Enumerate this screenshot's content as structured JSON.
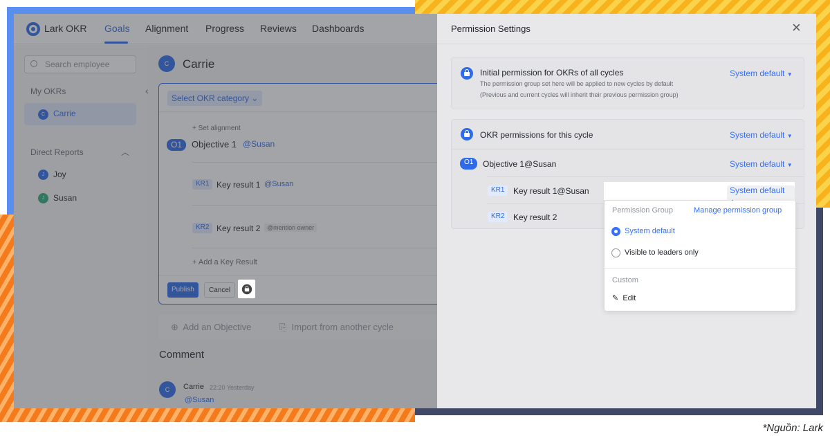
{
  "app": {
    "brand": "Lark OKR",
    "nav": [
      "Goals",
      "Alignment",
      "Progress",
      "Reviews",
      "Dashboards"
    ],
    "active_nav": "Goals"
  },
  "sidebar": {
    "search_placeholder": "Search employee",
    "my_okrs": "My OKRs",
    "me": {
      "initial": "C",
      "name": "Carrie"
    },
    "direct_reports": "Direct Reports",
    "reports": [
      {
        "initial": "J",
        "name": "Joy",
        "color": "#2d6bea"
      },
      {
        "initial": "J",
        "name": "Susan",
        "color": "#2ea87a"
      }
    ]
  },
  "main": {
    "owner": {
      "initial": "C",
      "name": "Carrie"
    },
    "category": "Select OKR category",
    "set_alignment": "+ Set alignment",
    "objective": {
      "tag": "O1",
      "title": "Objective 1",
      "mention": "@Susan"
    },
    "krs": [
      {
        "tag": "KR1",
        "title": "Key result 1",
        "mention": "@Susan"
      },
      {
        "tag": "KR2",
        "title": "Key result 2",
        "mention": "@mention owner"
      }
    ],
    "add_kr": "Add a Key Result",
    "publish": "Publish",
    "cancel": "Cancel",
    "add_objective": "Add an Objective",
    "import": "Import from another cycle",
    "comment_title": "Comment",
    "comment": {
      "initial": "C",
      "author": "Carrie",
      "time": "22:20 Yesterday",
      "text": "@Susan"
    }
  },
  "panel": {
    "title": "Permission Settings",
    "initial_title": "Initial permission for OKRs of all cycles",
    "initial_desc1": "The permission group set here will be applied to new cycles by default",
    "initial_desc2": "(Previous and current cycles will inherit their previous permission group)",
    "cycle_title": "OKR permissions for this cycle",
    "objective": {
      "tag": "O1",
      "title": "Objective 1@Susan"
    },
    "krs": [
      {
        "tag": "KR1",
        "title": "Key result 1@Susan"
      },
      {
        "tag": "KR2",
        "title": "Key result 2"
      }
    ],
    "value": "System default"
  },
  "dropdown": {
    "group_label": "Permission Group",
    "manage": "Manage permission group",
    "options": [
      "System default",
      "Visible to leaders only"
    ],
    "selected": "System default",
    "custom_label": "Custom",
    "edit": "Edit"
  },
  "caption": "*Nguồn: Lark",
  "colors": {
    "accent": "#2d6bea",
    "link": "#3370ff"
  }
}
